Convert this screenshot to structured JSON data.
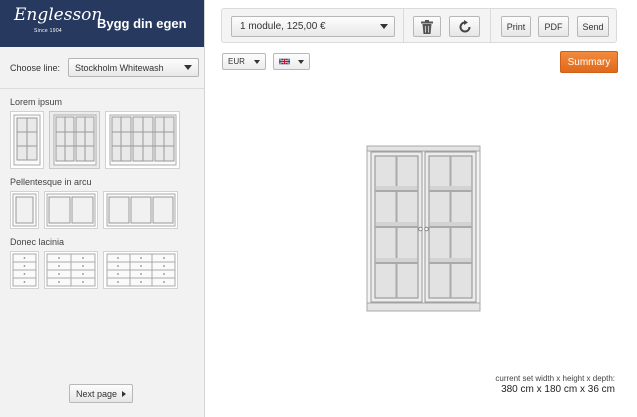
{
  "brand": {
    "logo_text": "Englesson",
    "logo_since": "Since 1904",
    "title": "Bygg din egen"
  },
  "sidebar": {
    "choose_line_label": "Choose line:",
    "line_value": "Stockholm Whitewash",
    "sections": [
      {
        "title": "Lorem ipsum"
      },
      {
        "title": "Pellentesque in arcu"
      },
      {
        "title": "Donec lacinia"
      }
    ],
    "next_page_label": "Next page"
  },
  "toolbar": {
    "module_value": "1 module, 125,00 €",
    "delete_icon": "trash-icon",
    "rotate_icon": "rotate-icon",
    "print_label": "Print",
    "pdf_label": "PDF",
    "send_label": "Send"
  },
  "controls": {
    "currency_value": "EUR",
    "language_flag": "uk-flag-icon",
    "summary_label": "Summary"
  },
  "dimensions": {
    "label": "current set width x height x depth:",
    "value": "380 cm x 180 cm x 36 cm"
  },
  "colors": {
    "brand_bg": "#27395e",
    "accent": "#e8782a"
  }
}
